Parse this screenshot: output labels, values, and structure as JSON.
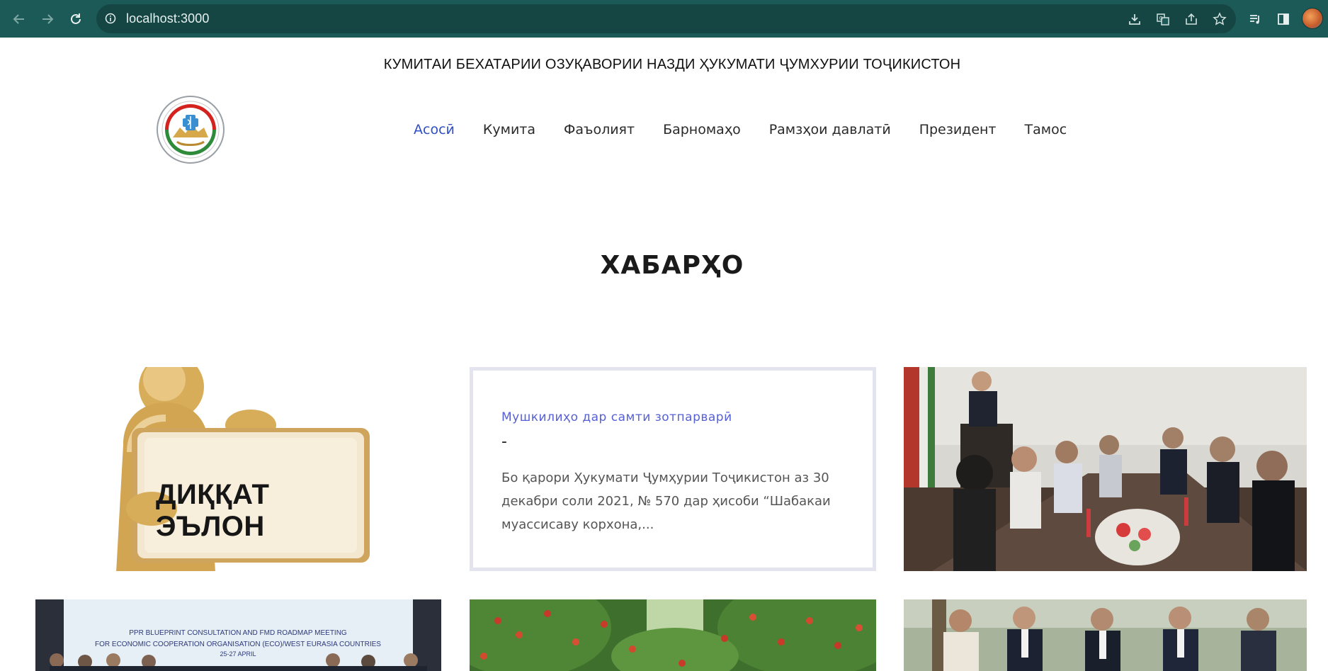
{
  "browser": {
    "url": "localhost:3000"
  },
  "site": {
    "title": "КУМИТАИ БЕХАТАРИИ ОЗУҚАВОРИИ НАЗДИ ҲУКУМАТИ ҶУМХУРИИ ТОҶИКИСТОН",
    "nav": [
      {
        "label": "Асосӣ",
        "active": true
      },
      {
        "label": "Кумита",
        "active": false
      },
      {
        "label": "Фаъолият",
        "active": false
      },
      {
        "label": "Барномаҳо",
        "active": false
      },
      {
        "label": "Рамзҳои давлатӣ",
        "active": false
      },
      {
        "label": "Президент",
        "active": false
      },
      {
        "label": "Тамос",
        "active": false
      }
    ]
  },
  "news": {
    "heading": "ХАБАРҲО",
    "attention_image_text": "ДИҚҚАТ ЭЪЛОН",
    "featured": {
      "title": "Мушкилиҳо дар самти зотпарварӣ",
      "dash": "-",
      "excerpt": "Бо қарори Ҳукумати Ҷумҳурии Тоҷикистон аз 30 декабри соли 2021, № 570 дар ҳисоби “Шабакаи муассисаву корхона,..."
    },
    "banner": {
      "line1": "PPR BLUEPRINT CONSULTATION AND FMD ROADMAP MEETING",
      "line2": "FOR ECONOMIC COOPERATION ORGANISATION (ECO)/WEST EURASIA COUNTRIES",
      "line3": "25-27 APRIL"
    }
  },
  "colors": {
    "chrome": "#1b5a57",
    "nav_active": "#2f4fc5",
    "news_title": "#5660d6"
  }
}
